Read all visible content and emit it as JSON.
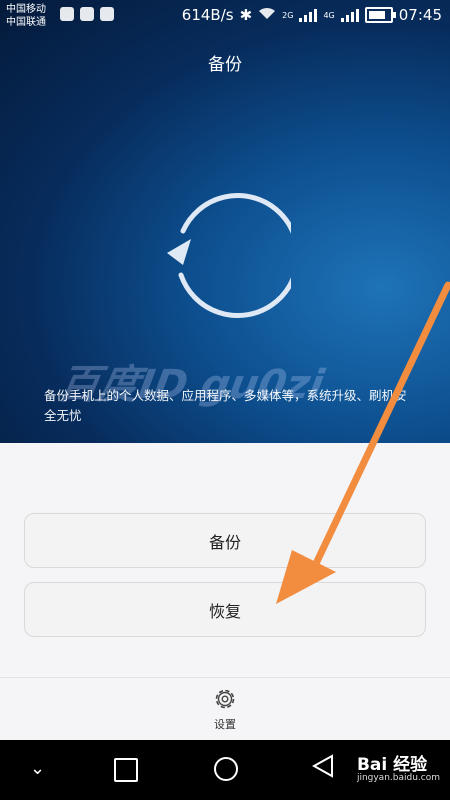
{
  "status_bar": {
    "carrier_1": "中国移动",
    "carrier_2": "中国联通",
    "speed": "614B/s",
    "net_2g": "2G",
    "net_4g": "4G",
    "time": "07:45"
  },
  "header": {
    "title": "备份"
  },
  "main": {
    "description": "备份手机上的个人数据、应用程序、多媒体等，系统升级、刷机安全无忧",
    "watermark": "百度ID gu0zi",
    "backup_button": "备份",
    "restore_button": "恢复"
  },
  "footer": {
    "settings_label": "设置"
  },
  "branding": {
    "logo": "Bai 经验",
    "url": "jingyan.baidu.com"
  },
  "colors": {
    "annotation_arrow": "#f28c3f",
    "top_bg": "#0a3f7a",
    "bottom_bg": "#f5f4f6"
  }
}
